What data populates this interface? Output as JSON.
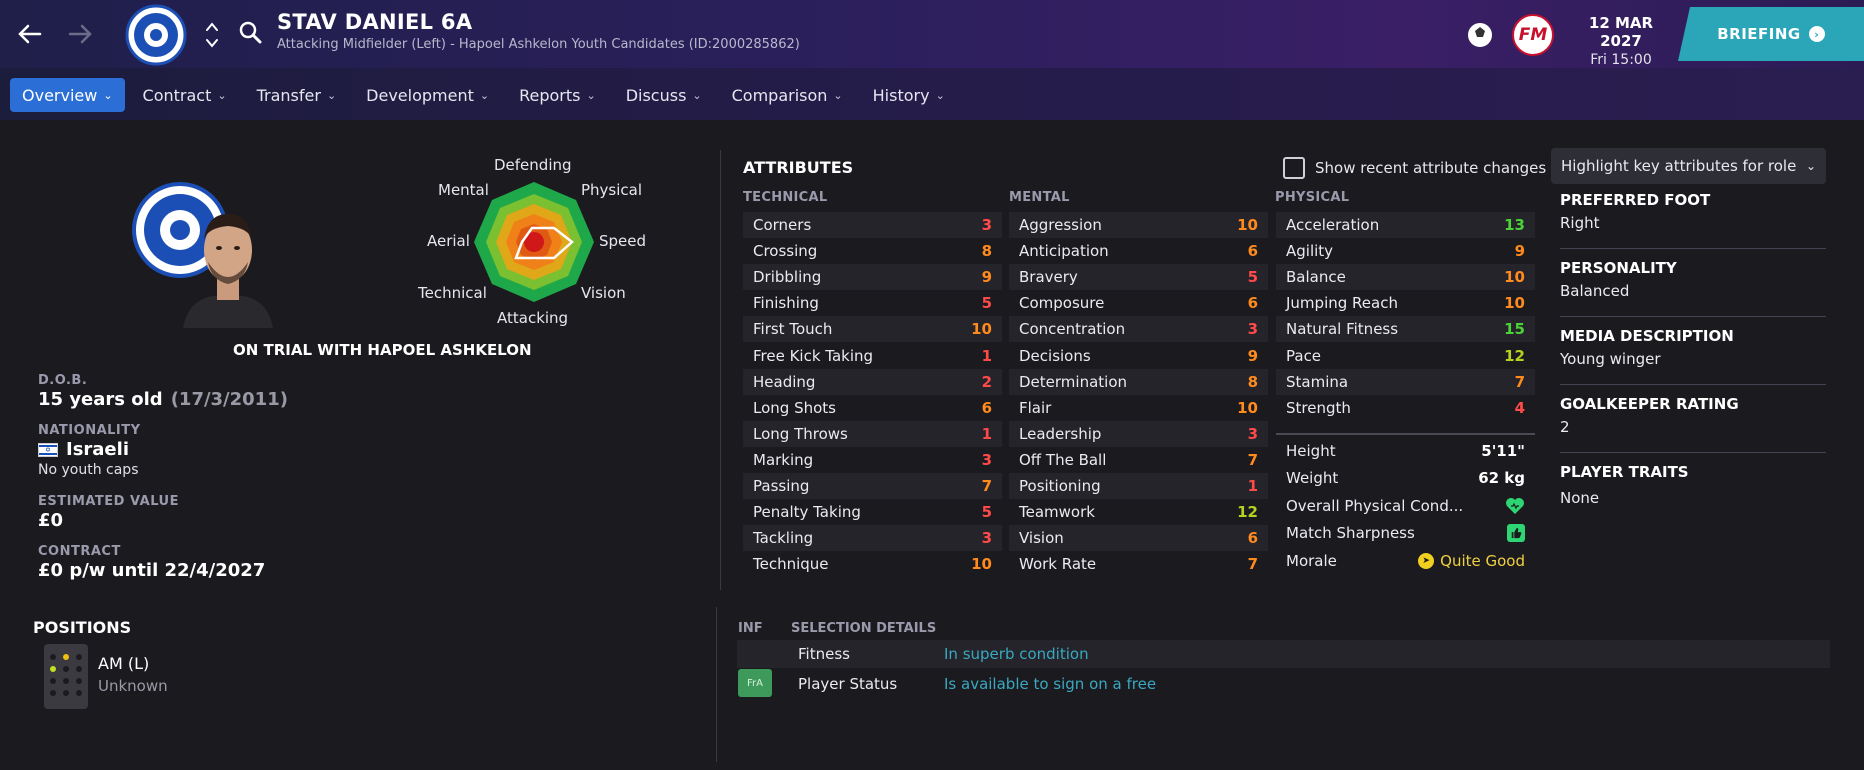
{
  "header": {
    "player_name": "STAV DANIEL 6A",
    "subtitle": "Attacking Midfielder (Left) - Hapoel Ashkelon Youth Candidates (ID:2000285862)",
    "date": "12 MAR 2027",
    "day_time": "Fri 15:00",
    "briefing_label": "BRIEFING",
    "fm_logo": "FM"
  },
  "nav": {
    "tabs": [
      {
        "label": "Overview",
        "active": true
      },
      {
        "label": "Contract"
      },
      {
        "label": "Transfer"
      },
      {
        "label": "Development"
      },
      {
        "label": "Reports"
      },
      {
        "label": "Discuss"
      },
      {
        "label": "Comparison"
      },
      {
        "label": "History"
      }
    ]
  },
  "profile": {
    "trial_text": "ON TRIAL WITH HAPOEL ASHKELON",
    "radar_labels": {
      "defending": "Defending",
      "physical": "Physical",
      "speed": "Speed",
      "vision": "Vision",
      "attacking": "Attacking",
      "technical": "Technical",
      "aerial": "Aerial",
      "mental": "Mental"
    },
    "dob_label": "D.O.B.",
    "age": "15 years old",
    "dob": "(17/3/2011)",
    "nationality_label": "NATIONALITY",
    "nationality": "Israeli",
    "youth_caps": "No youth caps",
    "value_label": "ESTIMATED VALUE",
    "value": "£0",
    "contract_label": "CONTRACT",
    "contract": "£0 p/w until 22/4/2027"
  },
  "positions": {
    "title": "POSITIONS",
    "position": "AM (L)",
    "familiarity": "Unknown"
  },
  "attributes": {
    "title": "ATTRIBUTES",
    "show_changes_label": "Show recent attribute changes",
    "highlight_label": "Highlight key attributes for role",
    "technical_head": "TECHNICAL",
    "mental_head": "MENTAL",
    "physical_head": "PHYSICAL",
    "technical": [
      {
        "name": "Corners",
        "value": "3"
      },
      {
        "name": "Crossing",
        "value": "8"
      },
      {
        "name": "Dribbling",
        "value": "9"
      },
      {
        "name": "Finishing",
        "value": "5"
      },
      {
        "name": "First Touch",
        "value": "10"
      },
      {
        "name": "Free Kick Taking",
        "value": "1"
      },
      {
        "name": "Heading",
        "value": "2"
      },
      {
        "name": "Long Shots",
        "value": "6"
      },
      {
        "name": "Long Throws",
        "value": "1"
      },
      {
        "name": "Marking",
        "value": "3"
      },
      {
        "name": "Passing",
        "value": "7"
      },
      {
        "name": "Penalty Taking",
        "value": "5"
      },
      {
        "name": "Tackling",
        "value": "3"
      },
      {
        "name": "Technique",
        "value": "10"
      }
    ],
    "mental": [
      {
        "name": "Aggression",
        "value": "10"
      },
      {
        "name": "Anticipation",
        "value": "6"
      },
      {
        "name": "Bravery",
        "value": "5"
      },
      {
        "name": "Composure",
        "value": "6"
      },
      {
        "name": "Concentration",
        "value": "3"
      },
      {
        "name": "Decisions",
        "value": "9"
      },
      {
        "name": "Determination",
        "value": "8"
      },
      {
        "name": "Flair",
        "value": "10"
      },
      {
        "name": "Leadership",
        "value": "3"
      },
      {
        "name": "Off The Ball",
        "value": "7"
      },
      {
        "name": "Positioning",
        "value": "1"
      },
      {
        "name": "Teamwork",
        "value": "12"
      },
      {
        "name": "Vision",
        "value": "6"
      },
      {
        "name": "Work Rate",
        "value": "7"
      }
    ],
    "physical": [
      {
        "name": "Acceleration",
        "value": "13"
      },
      {
        "name": "Agility",
        "value": "9"
      },
      {
        "name": "Balance",
        "value": "10"
      },
      {
        "name": "Jumping Reach",
        "value": "10"
      },
      {
        "name": "Natural Fitness",
        "value": "15"
      },
      {
        "name": "Pace",
        "value": "12"
      },
      {
        "name": "Stamina",
        "value": "7"
      },
      {
        "name": "Strength",
        "value": "4"
      }
    ],
    "height_label": "Height",
    "height": "5'11\"",
    "weight_label": "Weight",
    "weight": "62 kg",
    "condition_label": "Overall Physical Cond...",
    "sharpness_label": "Match Sharpness",
    "morale_label": "Morale",
    "morale": "Quite Good"
  },
  "side_info": {
    "foot_label": "PREFERRED FOOT",
    "foot": "Right",
    "personality_label": "PERSONALITY",
    "personality": "Balanced",
    "media_label": "MEDIA DESCRIPTION",
    "media": "Young winger",
    "gk_label": "GOALKEEPER RATING",
    "gk": "2",
    "traits_label": "PLAYER TRAITS",
    "traits": "None"
  },
  "selection": {
    "inf_head": "INF",
    "details_head": "SELECTION DETAILS",
    "fitness_label": "Fitness",
    "fitness": "In superb condition",
    "status_badge": "FrA",
    "status_label": "Player Status",
    "status": "Is available to sign on a free"
  },
  "colors": {
    "accent": "#2b6fd6",
    "briefing": "#2aa6b8",
    "attr_red": "#ff4a4a",
    "attr_orange": "#ff8a1e",
    "attr_yellowgreen": "#b8d020",
    "attr_green": "#4cd137"
  }
}
